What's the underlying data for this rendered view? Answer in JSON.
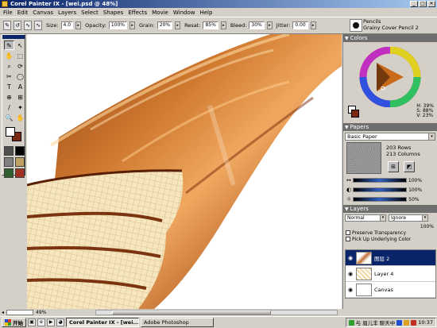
{
  "window": {
    "title": "Corel Painter IX - [wei.psd @ 48%]",
    "buttons": {
      "minimize": "_",
      "maximize": "□",
      "close": "✕"
    }
  },
  "menu": [
    "File",
    "Edit",
    "Canvas",
    "Layers",
    "Select",
    "Shapes",
    "Effects",
    "Movie",
    "Window",
    "Help"
  ],
  "property_bar": {
    "size_label": "Size:",
    "size_value": "4.0",
    "opacity_label": "Opacity:",
    "opacity_value": "100%",
    "grain_label": "Grain:",
    "grain_value": "20%",
    "resat_label": "Resat:",
    "resat_value": "85%",
    "bleed_label": "Bleed:",
    "bleed_value": "30%",
    "jitter_label": "Jitter:",
    "jitter_value": "0.00"
  },
  "brush": {
    "category": "Pencils",
    "variant": "Grainy Cover Pencil 2"
  },
  "toolbox": {
    "tools": [
      "✎",
      "↖",
      "✋",
      "⬚",
      "⌕",
      "⟳",
      "✂",
      "◯",
      "T",
      "A",
      "⊕",
      "⊞",
      "/",
      "✦",
      "🔍",
      "✋"
    ],
    "main_color": "#ffffff",
    "additional_color": "#7a2a10",
    "swatches": [
      "#505050",
      "#000000",
      "#808080",
      "#c0a060",
      "#306030",
      "#a03020"
    ]
  },
  "colors_palette": {
    "title": "Colors",
    "h": "H: 39%",
    "s": "S: 88%",
    "v": "V: 23%"
  },
  "papers_palette": {
    "title": "Papers",
    "selected": "Basic Paper",
    "rows": "203 Rows",
    "columns": "213 Columns",
    "slider1": "100%",
    "slider2": "100%",
    "slider3": "50%"
  },
  "layers_palette": {
    "title": "Layers",
    "composite_method": "Normal",
    "depth": "Ignore",
    "opacity": "100%",
    "preserve_transparency": "Preserve Transparency",
    "pick_up": "Pick Up Underlying Color",
    "layers": [
      "图层 2",
      "Layer 4",
      "Canvas"
    ]
  },
  "statusbar": {
    "zoom": "49%"
  },
  "taskbar": {
    "start": "开始",
    "tasks": [
      "Corel Painter IX - [wei...",
      "Adobe Photoshop"
    ],
    "tray_text": "与 眉儿丰 聊天中",
    "clock": "10:37"
  },
  "colors": {
    "titlebar_start": "#0a246a",
    "chocolate": "#b8642a",
    "wafer": "#f2dca8"
  }
}
